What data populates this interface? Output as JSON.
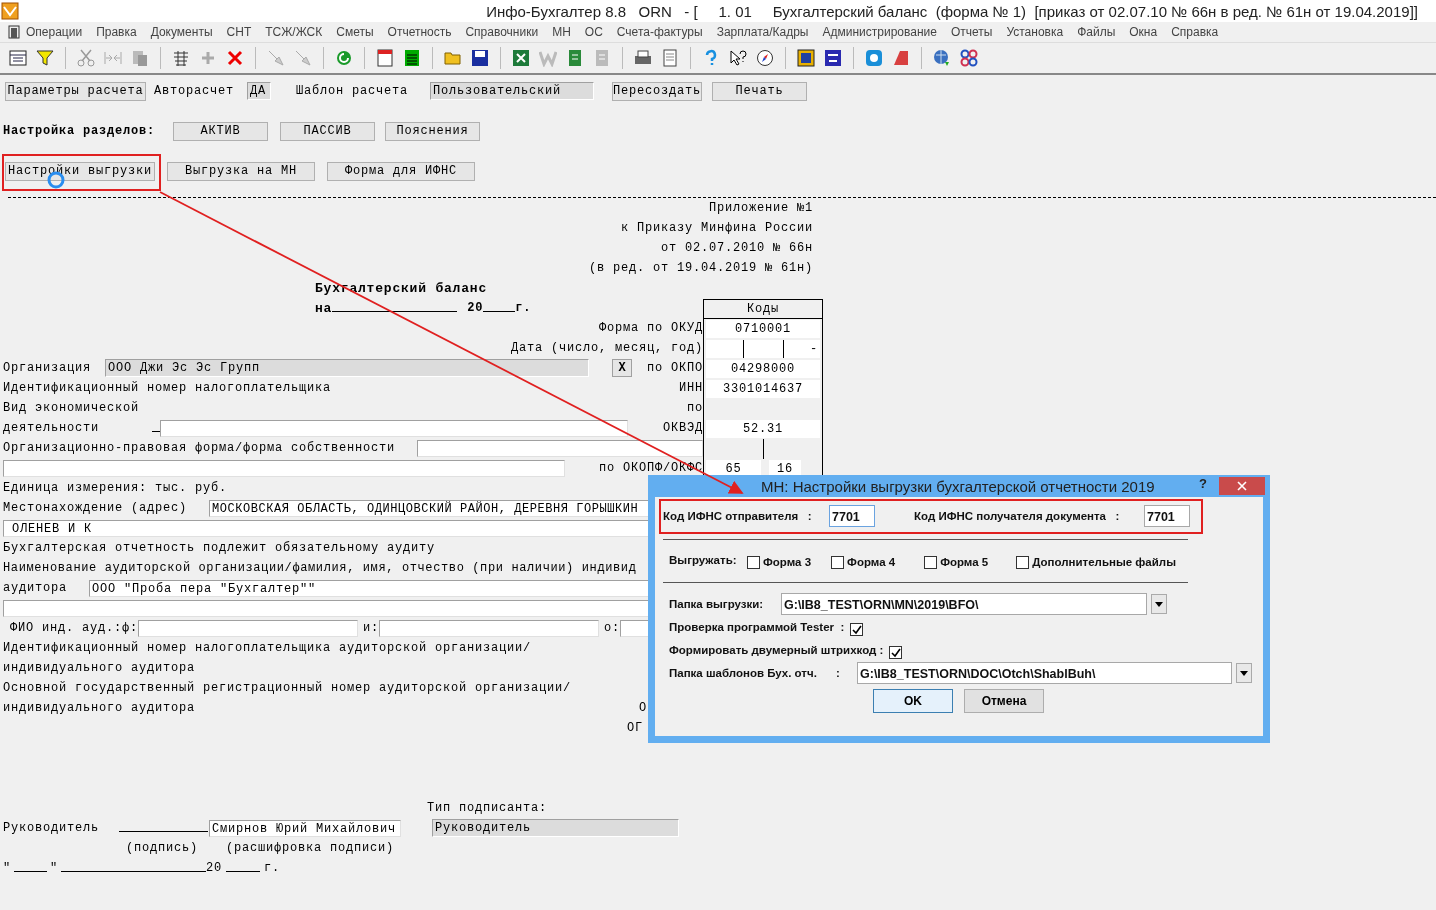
{
  "window": {
    "title": "Инфо-Бухгалтер 8.8   ORN   - [     1. 01     Бухгалтерский баланс  (форма № 1)  [приказ от 02.07.10 № 66н в ред. № 61н от 19.04.2019]]"
  },
  "menu": [
    "Операции",
    "Правка",
    "Документы",
    "СНТ",
    "ТСЖ/ЖСК",
    "Сметы",
    "Отчетность",
    "Справочники",
    "МН",
    "ОС",
    "Счета-фактуры",
    "Зарплата/Кадры",
    "Администрирование",
    "Отчеты",
    "Установка",
    "Файлы",
    "Окна",
    "Справка"
  ],
  "params_bar": {
    "calc_params_button": "Параметры расчета",
    "autocalc_label": "Авторасчет",
    "autocalc_value": "ДА",
    "template_label": "Шаблон расчета",
    "template_value": "Пользовательский",
    "recreate_button": "Пересоздать",
    "print_button": "Печать"
  },
  "sections": {
    "label": "Настройка разделов:",
    "buttons": [
      "АКТИВ",
      "ПАССИВ",
      "Пояснения"
    ]
  },
  "export_buttons": [
    "Настройки выгрузки",
    "Выгрузка на МН",
    "Форма для ИФНС"
  ],
  "form": {
    "appendix": [
      "Приложение №1",
      "к Приказу Минфина России",
      "от 02.07.2010 № 66н",
      "(в ред. от 19.04.2019 № 61н)"
    ],
    "title": "Бухгалтерский баланс",
    "date_on": "на",
    "date_year": "20",
    "date_g": "г.",
    "codes_header": "Коды",
    "okud_label": "Форма по ОКУД",
    "okud": "0710001",
    "date_label": "Дата (число, месяц, год)",
    "date_dash": "-",
    "org_label": "Организация",
    "org_value": "ООО Джи Эс Эс Групп",
    "clear_button": "X",
    "okpo_label": "по ОКПО",
    "okpo": "04298000",
    "inn_label": "Идентификационный номер налогоплательщика",
    "inn_code_label": "ИНН",
    "inn": "3301014637",
    "activity_label_1": "Вид экономической",
    "activity_label_2": "деятельности",
    "okved_label_1": "по",
    "okved_label_2": "ОКВЭД",
    "okved": "52.31",
    "legal_form_label": "Организационно-правовая форма/форма собственности",
    "okopf_label": "по ОКОПФ/ОКФС",
    "okopf": "65",
    "okfs": "16",
    "unit_label": "Единица измерения: тыс. руб.",
    "address_label": "Местонахождение (адрес)",
    "address_line_1": "МОСКОВСКАЯ ОБЛАСТЬ, ОДИНЦОВСКИЙ РАЙОН, ДЕРЕВНЯ ГОРЫШКИН",
    "address_line_2": "ОЛЕНЕВ И К",
    "audit_note": "Бухгалтерская отчетность подлежит обязательному аудиту",
    "auditor_name_label_1": "Наименование аудиторской организации/фамилия, имя, отчество (при наличии) индивид",
    "auditor_name_label_2": "аудитора",
    "auditor_name": "ООО \"Проба пера \"Бухгалтер\"\"",
    "fio_label": "ФИО инд. ауд.:",
    "fio_f": "ф:",
    "fio_i": "и:",
    "fio_o": "о:",
    "auditor_inn_label": [
      "Идентификационный номер налогоплательщика аудиторской организации/",
      "индивидуального аудитора"
    ],
    "auditor_ogrn_label": [
      "Основной государственный регистрационный номер аудиторской организации/",
      "индивидуального аудитора"
    ],
    "cut_labels": [
      "О",
      "ОГ"
    ],
    "signer_type_label": "Тип подписанта:",
    "head_label": "Руководитель",
    "head_name": "Смирнов Юрий Михайлович",
    "signer_type": "Руководитель",
    "signature_caption": "(подпись)",
    "decode_caption": "(расшифровка подписи)",
    "quote_open": "\"",
    "quote_close": "\"",
    "sign_year": "20",
    "sign_g": "г."
  },
  "dialog": {
    "title": "МН: Настройки выгрузки бухгалтерской отчетности 2019",
    "help": "?",
    "sender_label": "Код ИФНС отправителя   :",
    "sender": "7701",
    "receiver_label": "Код ИФНС получателя документа   :",
    "receiver": "7701",
    "export_label": "Выгружать:",
    "export_options": [
      {
        "label": "Форма 3",
        "checked": false
      },
      {
        "label": "Форма 4",
        "checked": false
      },
      {
        "label": "Форма 5",
        "checked": false
      },
      {
        "label": "Дополнительные файлы",
        "checked": false
      }
    ],
    "folder_label": "Папка выгрузки:",
    "folder": "G:\\IB8_TEST\\ORN\\MN\\2019\\BFO\\",
    "tester_label": "Проверка программой Tester  :",
    "tester_checked": true,
    "barcode_label": "Формировать двумерный штрихкод :",
    "barcode_checked": true,
    "templates_label": "Папка шаблонов Бух. отч.      :",
    "templates": "G:\\IB8_TEST\\ORN\\DOC\\Otch\\ShablBuh\\",
    "ok_button": "OK",
    "cancel_button": "Отмена"
  }
}
